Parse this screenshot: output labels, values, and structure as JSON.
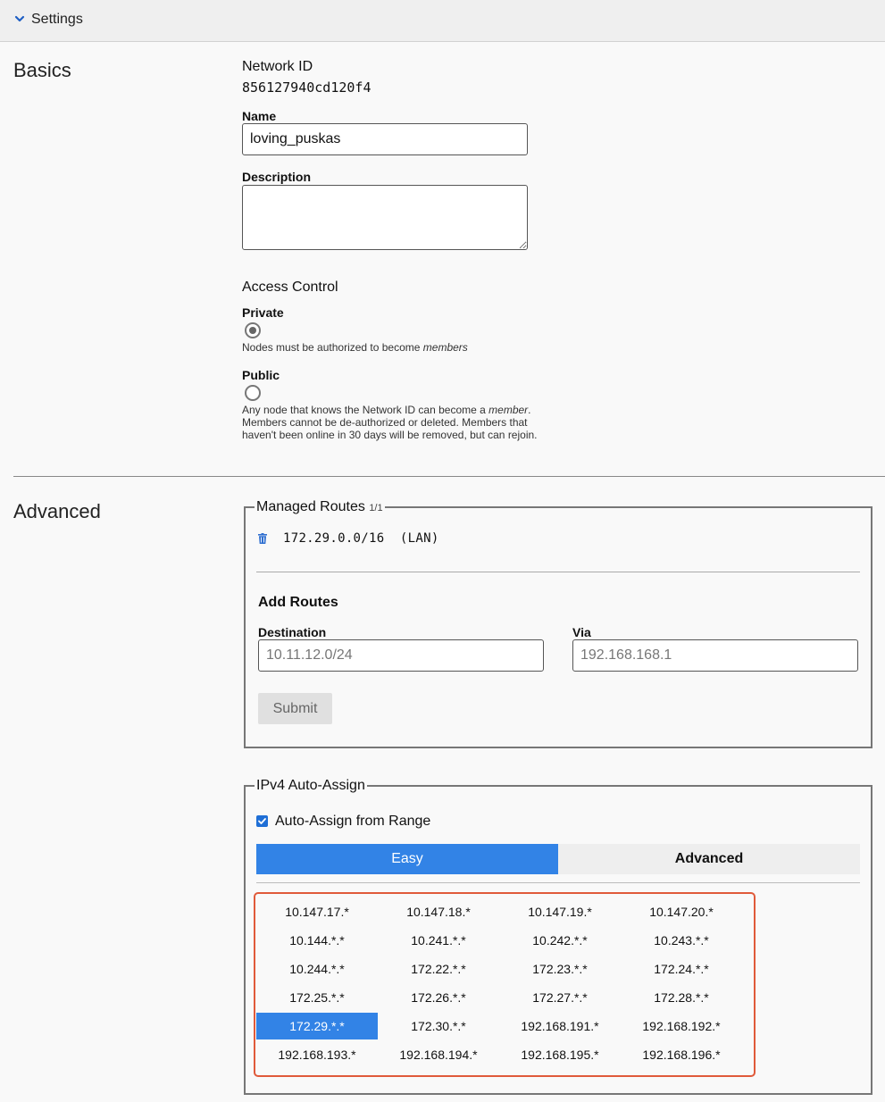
{
  "header": {
    "title": "Settings"
  },
  "basics": {
    "section_title": "Basics",
    "network_id_label": "Network ID",
    "network_id": "856127940cd120f4",
    "name_label": "Name",
    "name_value": "loving_puskas",
    "description_label": "Description",
    "description_value": "",
    "access_control_label": "Access Control",
    "private_label": "Private",
    "private_desc_prefix": "Nodes must be authorized to become",
    "private_desc_em": "members",
    "public_label": "Public",
    "public_desc_prefix": "Any node that knows the Network ID can become a",
    "public_desc_em": "member",
    "public_desc_dot": ".",
    "public_desc_line2": "Members cannot be de-authorized or deleted. Members that",
    "public_desc_line3": "haven't been online in 30 days will be removed, but can rejoin.",
    "access_selected": "Private"
  },
  "advanced": {
    "section_title": "Advanced",
    "managed_routes": {
      "legend": "Managed Routes",
      "count": "1/1",
      "routes": [
        {
          "text": "172.29.0.0/16  (LAN)"
        }
      ],
      "add_routes_label": "Add Routes",
      "destination_label": "Destination",
      "destination_placeholder": "10.11.12.0/24",
      "via_label": "Via",
      "via_placeholder": "192.168.168.1",
      "submit_label": "Submit"
    },
    "ipv4": {
      "legend": "IPv4 Auto-Assign",
      "auto_assign_label": "Auto-Assign from Range",
      "auto_assign_checked": true,
      "tabs": [
        {
          "label": "Easy",
          "active": true
        },
        {
          "label": "Advanced",
          "active": false
        }
      ],
      "ranges": [
        "10.147.17.*",
        "10.147.18.*",
        "10.147.19.*",
        "10.147.20.*",
        "10.144.*.*",
        "10.241.*.*",
        "10.242.*.*",
        "10.243.*.*",
        "10.244.*.*",
        "172.22.*.*",
        "172.23.*.*",
        "172.24.*.*",
        "172.25.*.*",
        "172.26.*.*",
        "172.27.*.*",
        "172.28.*.*",
        "172.29.*.*",
        "172.30.*.*",
        "192.168.191.*",
        "192.168.192.*",
        "192.168.193.*",
        "192.168.194.*",
        "192.168.195.*",
        "192.168.196.*"
      ],
      "selected_range": "172.29.*.*"
    }
  },
  "colors": {
    "accent": "#3283e6",
    "highlight_border": "#e05a3a"
  }
}
